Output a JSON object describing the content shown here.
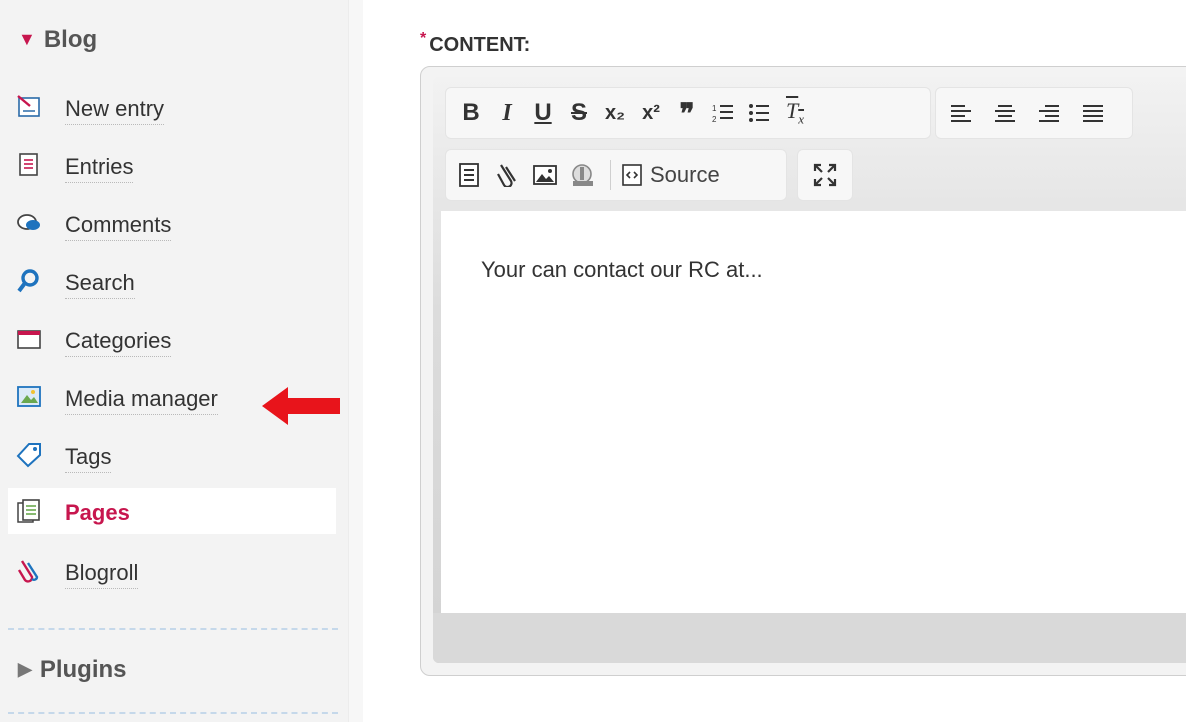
{
  "sidebar": {
    "section_title": "Blog",
    "items": [
      {
        "label": "New entry",
        "icon": "new-entry-icon"
      },
      {
        "label": "Entries",
        "icon": "entries-icon"
      },
      {
        "label": "Comments",
        "icon": "comments-icon"
      },
      {
        "label": "Search",
        "icon": "search-icon"
      },
      {
        "label": "Categories",
        "icon": "categories-icon"
      },
      {
        "label": "Media manager",
        "icon": "media-icon"
      },
      {
        "label": "Tags",
        "icon": "tag-icon"
      },
      {
        "label": "Pages",
        "icon": "pages-icon",
        "active": true
      },
      {
        "label": "Blogroll",
        "icon": "blogroll-icon"
      }
    ],
    "plugins_title": "Plugins"
  },
  "annotation": {
    "arrow_target": "Media manager",
    "arrow_color": "#e8141b"
  },
  "field": {
    "required_mark": "*",
    "label": "CONTENT:"
  },
  "editor": {
    "toolbar_row1": [
      "B",
      "I",
      "U",
      "S",
      "x₂",
      "x²",
      "❞",
      "1≡",
      "•≡",
      "Tx",
      "align-left",
      "align-center",
      "align-right",
      "justify"
    ],
    "toolbar_row2": [
      "template-icon",
      "link-icon",
      "image-icon",
      "media-icon",
      "source-icon",
      "maximize-icon"
    ],
    "source_label": "Source",
    "content": "Your can contact our RC at..."
  },
  "colors": {
    "accent": "#c7164e",
    "link_blue": "#1e73be"
  }
}
